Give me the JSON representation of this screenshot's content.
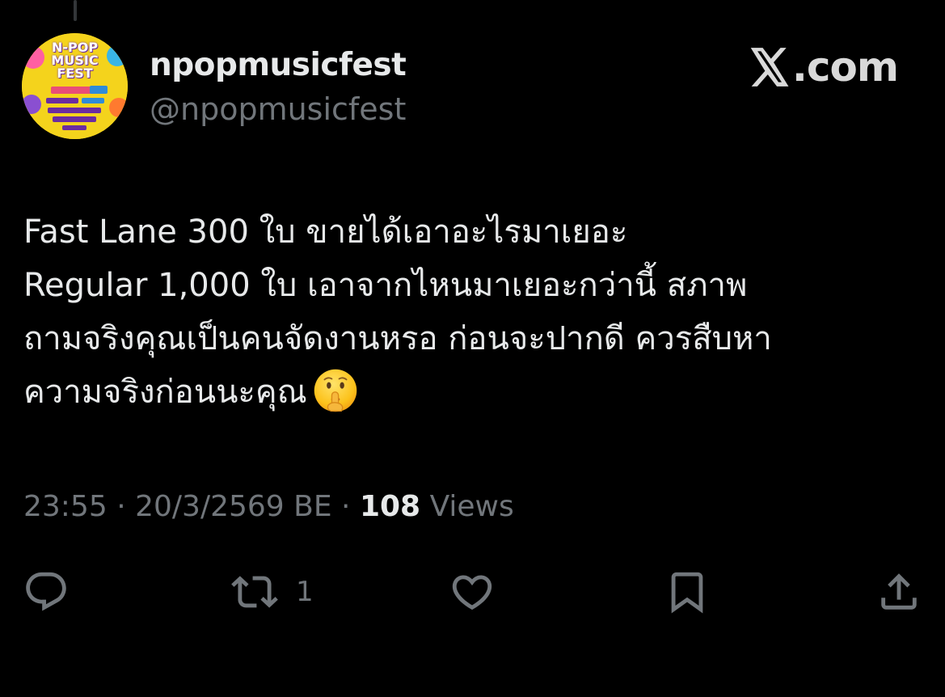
{
  "tweet": {
    "author": {
      "display_name": "npopmusicfest",
      "handle": "@npopmusicfest",
      "avatar_title": "N-POP\nMUSIC\nFEST"
    },
    "brand": {
      "text": ".com",
      "icon": "x-logo-icon"
    },
    "text_lines": [
      "Fast Lane 300 ใบ ขายได้เอาอะไรมาเยอะ",
      "Regular 1,000 ใบ เอาจากไหนมาเยอะกว่านี้ สภาพ",
      "ถามจริงคุณเป็นคนจัดงานหรอ ก่อนจะปากดี ควรสืบหา",
      "ความจริงก่อนนะคุณ"
    ],
    "emoji": "shushing-face-icon",
    "meta": {
      "time": "23:55",
      "separator": "·",
      "date": "20/3/2569 BE",
      "views_count": "108",
      "views_label": "Views"
    },
    "actions": {
      "reply": {
        "icon": "reply-icon",
        "count": ""
      },
      "retweet": {
        "icon": "retweet-icon",
        "count": "1"
      },
      "like": {
        "icon": "heart-icon",
        "count": ""
      },
      "bookmark": {
        "icon": "bookmark-icon",
        "count": ""
      },
      "share": {
        "icon": "share-icon",
        "count": ""
      }
    }
  },
  "colors": {
    "background": "#000000",
    "primary_text": "#e7e9ea",
    "secondary_text": "#71767b",
    "avatar_bg": "#f4d31c"
  }
}
